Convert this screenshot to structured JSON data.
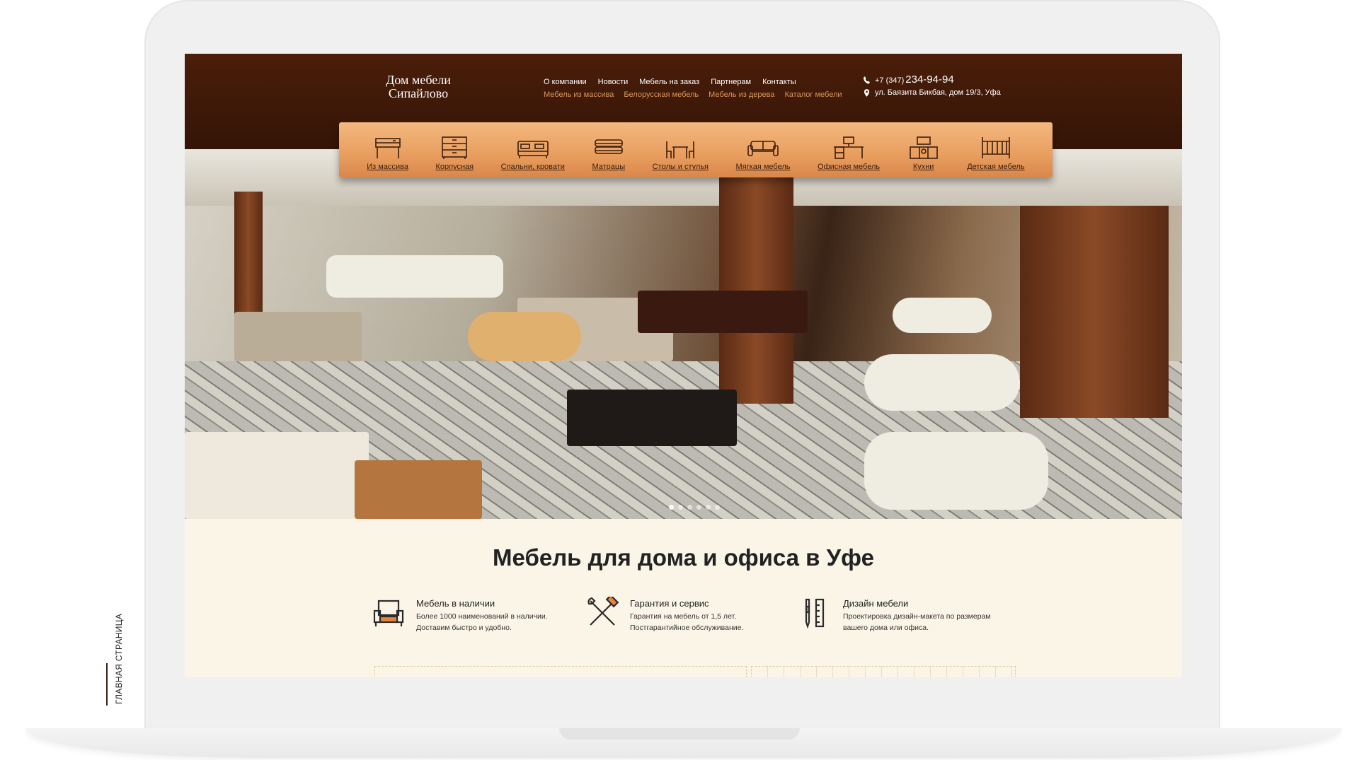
{
  "site": {
    "logo": {
      "line1": "Дом мебели",
      "line2": "Сипайлово"
    },
    "top_nav": [
      "О компании",
      "Новости",
      "Мебель на заказ",
      "Партнерам",
      "Контакты"
    ],
    "sub_nav": [
      "Мебель из массива",
      "Белорусская мебель",
      "Мебель из дерева",
      "Каталог мебели"
    ],
    "contact": {
      "phone_code": "+7 (347)",
      "phone_number": "234-94-94",
      "address": "ул. Баязита Бикбая, дом 19/3, Уфа"
    },
    "categories": [
      {
        "label": "Из массива",
        "icon": "dresser-table-icon"
      },
      {
        "label": "Корпусная",
        "icon": "chest-of-drawers-icon"
      },
      {
        "label": "Спальни, кровати",
        "icon": "bed-icon"
      },
      {
        "label": "Матрацы",
        "icon": "mattress-icon"
      },
      {
        "label": "Столы и стулья",
        "icon": "table-chairs-icon"
      },
      {
        "label": "Мягкая мебель",
        "icon": "sofa-icon"
      },
      {
        "label": "Офисная мебель",
        "icon": "office-desk-icon"
      },
      {
        "label": "Кухни",
        "icon": "kitchen-icon"
      },
      {
        "label": "Детская мебель",
        "icon": "crib-icon"
      }
    ],
    "slider": {
      "total": 6,
      "active": 1
    },
    "main_title": "Мебель для дома и офиса в Уфе",
    "features": [
      {
        "title": "Мебель в наличии",
        "text": "Более 1000 наименований в наличии. Доставим быстро и удобно.",
        "icon": "armchair-icon"
      },
      {
        "title": "Гарантия и сервис",
        "text": "Гарантия на мебель от 1,5 лет. Постгарантийное обслуживание.",
        "icon": "tools-icon"
      },
      {
        "title": "Дизайн мебели",
        "text": "Проектировка дизайн-макета по размерам вашего дома или офиса.",
        "icon": "pencil-ruler-icon"
      }
    ],
    "colors": {
      "header": "#3f1808",
      "accent": "#e89e5e",
      "link_sub": "#d8965a",
      "content_bg": "#fbf5e7"
    }
  },
  "caption": "ГЛАВНАЯ СТРАНИЦА"
}
